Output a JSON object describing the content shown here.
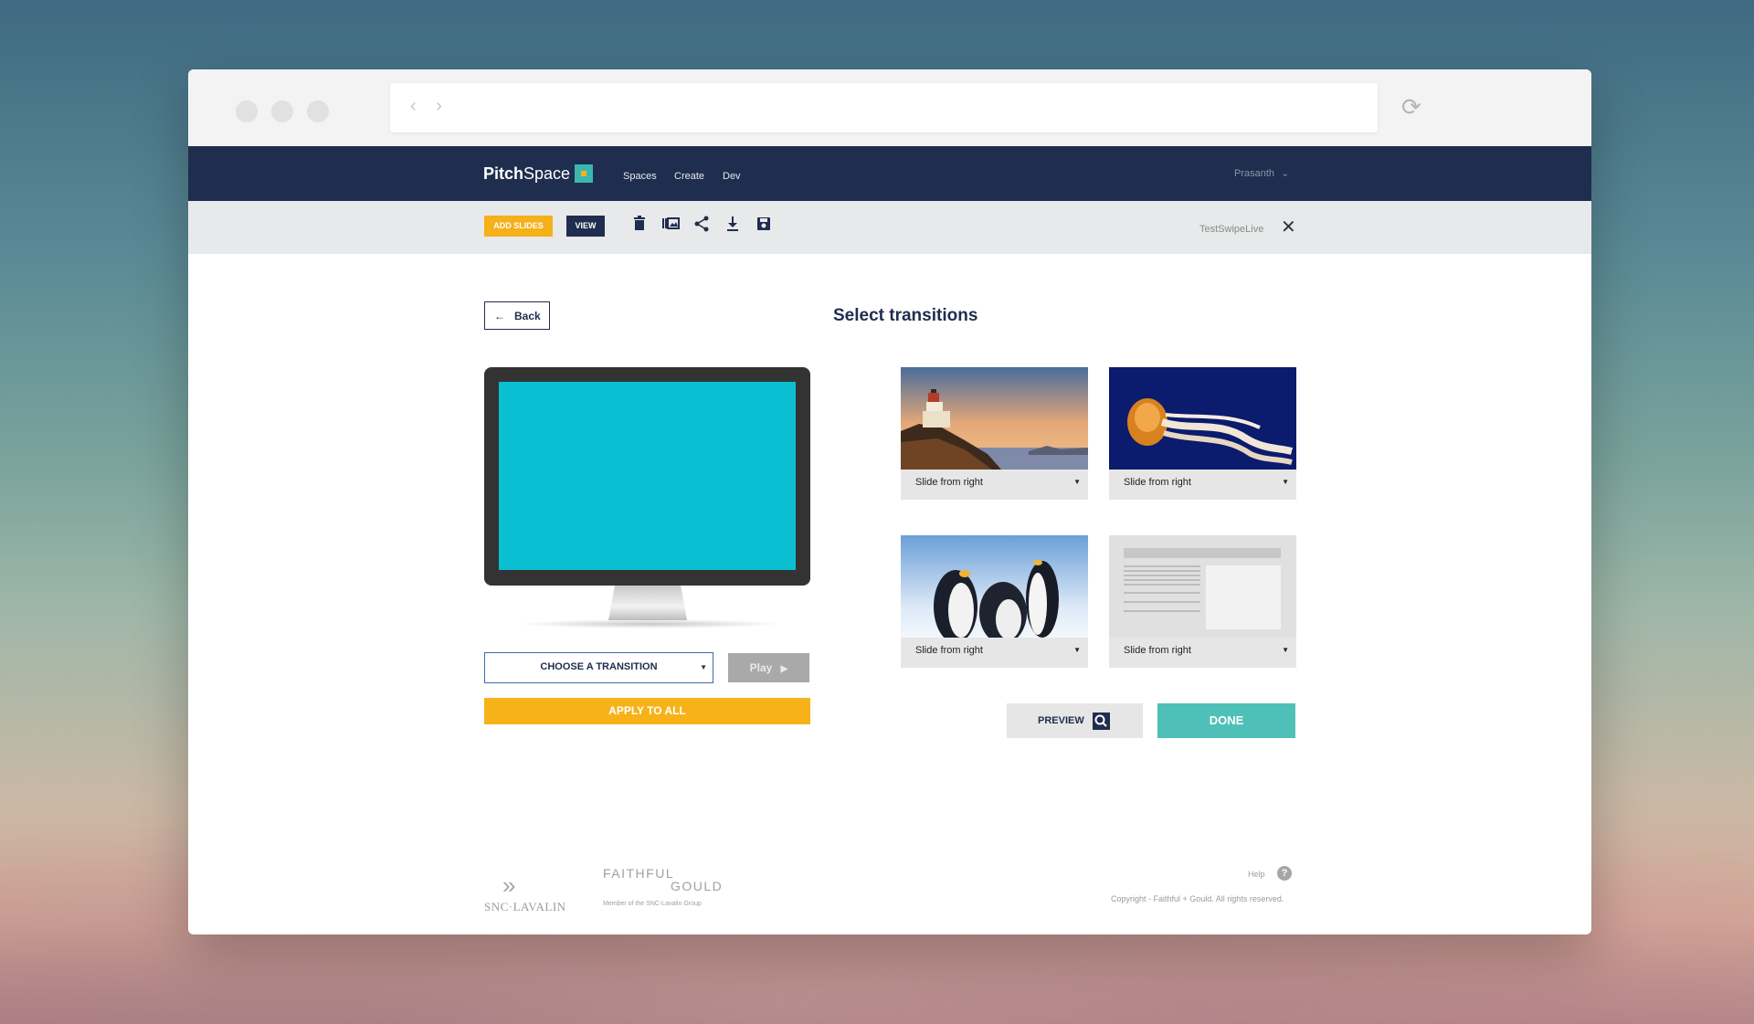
{
  "browser": {
    "nav_arrows": "‹  ›",
    "reload_icon": "reload-icon"
  },
  "header": {
    "logo_pitch": "Pitch",
    "logo_space": "Space",
    "nav": [
      "Spaces",
      "Create",
      "Dev"
    ],
    "user": "Prasanth"
  },
  "toolbar": {
    "add_slides": "ADD SLIDES",
    "view": "VIEW",
    "icons": [
      "trash-icon",
      "gallery-icon",
      "share-icon",
      "download-icon",
      "save-icon"
    ],
    "doc_name": "TestSwipeLive",
    "close": "✕"
  },
  "main": {
    "back_label": "Back",
    "heading": "Select transitions",
    "transition_select": "CHOOSE A TRANSITION",
    "play_label": "Play",
    "apply_label": "APPLY TO ALL",
    "screen_color": "#0bbfd2"
  },
  "thumbnails": [
    {
      "image": "lighthouse",
      "transition": "Slide from right"
    },
    {
      "image": "jellyfish",
      "transition": "Slide from right"
    },
    {
      "image": "penguins",
      "transition": "Slide from right"
    },
    {
      "image": "text-layout",
      "transition": "Slide from right"
    }
  ],
  "actions": {
    "preview": "PREVIEW",
    "done": "DONE"
  },
  "footer": {
    "snc": "SNC·LAVALIN",
    "fg_top": "FAITHFUL",
    "fg_bottom": "GOULD",
    "fg_sub": "Member of the SNC-Lavalin Group",
    "help": "Help",
    "help_icon": "?",
    "copyright": "Copyright - Faithful + Gould. All rights reserved."
  },
  "colors": {
    "navy": "#1f2d4e",
    "accent_yellow": "#f7b21a",
    "teal": "#4fc0b7"
  }
}
